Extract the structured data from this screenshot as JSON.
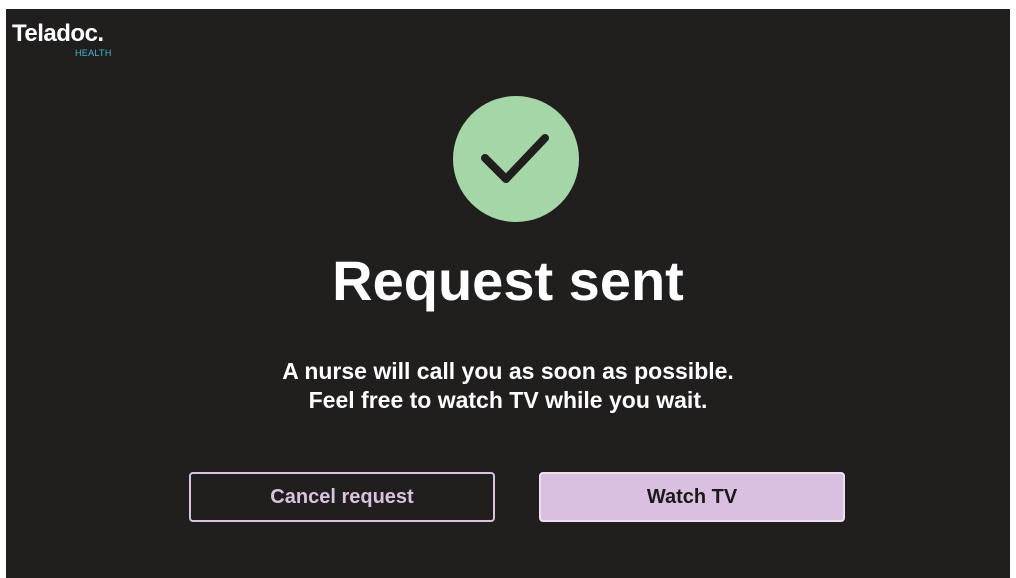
{
  "brand": {
    "name": "Teladoc.",
    "sub": "HEALTH"
  },
  "status": {
    "icon": "checkmark-icon",
    "title": "Request sent",
    "message_line1": "A nurse will call you as soon as possible.",
    "message_line2": "Feel free to watch TV while you wait."
  },
  "actions": {
    "cancel_label": "Cancel request",
    "watch_label": "Watch TV"
  },
  "colors": {
    "background": "#211e1e",
    "success_circle": "#a5d6a7",
    "accent_purple": "#d9bfe0",
    "brand_teal": "#41b6d9"
  }
}
